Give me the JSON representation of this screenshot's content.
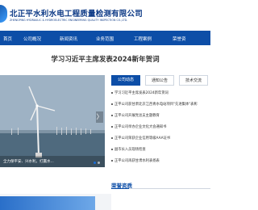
{
  "header": {
    "company_cn": "北正平水利水电工程质量检测有限公司",
    "company_en": "ZHENGPING HYDRAULIC & HYDROELECTRIC ENGINEERING QUALITY INSPECTION CO.,LTD."
  },
  "nav": {
    "items": [
      {
        "label": "首页"
      },
      {
        "label": "公司概况"
      },
      {
        "label": "新闻资讯"
      },
      {
        "label": "业务范围"
      },
      {
        "label": "工程案例"
      },
      {
        "label": "荣誉资"
      }
    ],
    "color": "#0d4ea7"
  },
  "headline": "学习习近平主席发表2024新年贺词",
  "slider": {
    "caption": "全力保平安、兴水利，打赢水...",
    "arrow": "〉"
  },
  "tabs": [
    {
      "label": "公司动态",
      "active": true
    },
    {
      "label": "通知公告",
      "active": false
    },
    {
      "label": "技术交流",
      "active": false
    }
  ],
  "news": [
    "学习习近平主席发表2024新年贺词",
    "正平公司获甘肃北京江西青水电站项目\"先进集体\"表彰",
    "正平公司开展党总支主题教育",
    "正平公司举办企业文化大会通知书",
    "正平公司荣获企业信用等级AAA证书",
    "副市长入员现场检查",
    "正平公司再获甘肃水利表扬表"
  ],
  "section": {
    "title": "荣誉资质"
  }
}
